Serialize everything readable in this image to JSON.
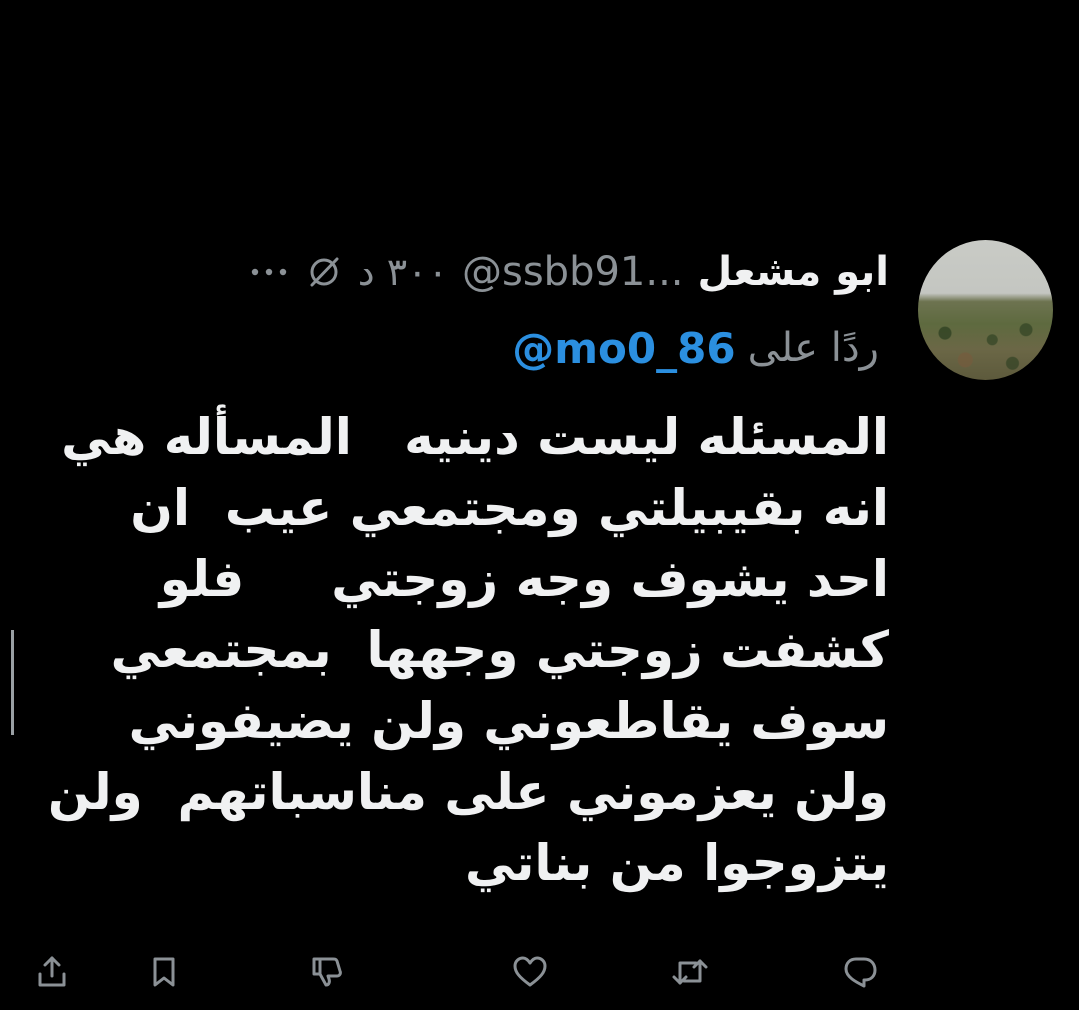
{
  "tweet": {
    "author": {
      "display_name": "ابو مشعل",
      "handle": "@ssbb91...",
      "time": "٣٠٠ د",
      "avatar_icon": "avatar-landscape-photo"
    },
    "reply": {
      "prefix": "ردًا على",
      "to_handle": "@mo0_86"
    },
    "body_lines": [
      "المسئله ليست دينيه   المسأله هي",
      "انه بقيبيلتي ومجتمعي عيب  ان",
      "احد يشوف وجه زوجتي     فلو",
      "كشفت زوجتي وجهها  بمجتمعي",
      "سوف يقاطعوني ولن يضيفوني",
      "ولن يعزموني على مناسباتهم  ولن",
      "يتزوجوا من بناتي"
    ],
    "header_icons": [
      "more-icon",
      "muted-icon"
    ],
    "actions": [
      "reply-icon",
      "retweet-icon",
      "like-icon",
      "dislike-icon",
      "bookmark-icon",
      "share-icon"
    ],
    "colors": {
      "background": "#000000",
      "text": "#f0f1f2",
      "muted": "#8b9196",
      "link": "#2b8fe0"
    }
  }
}
